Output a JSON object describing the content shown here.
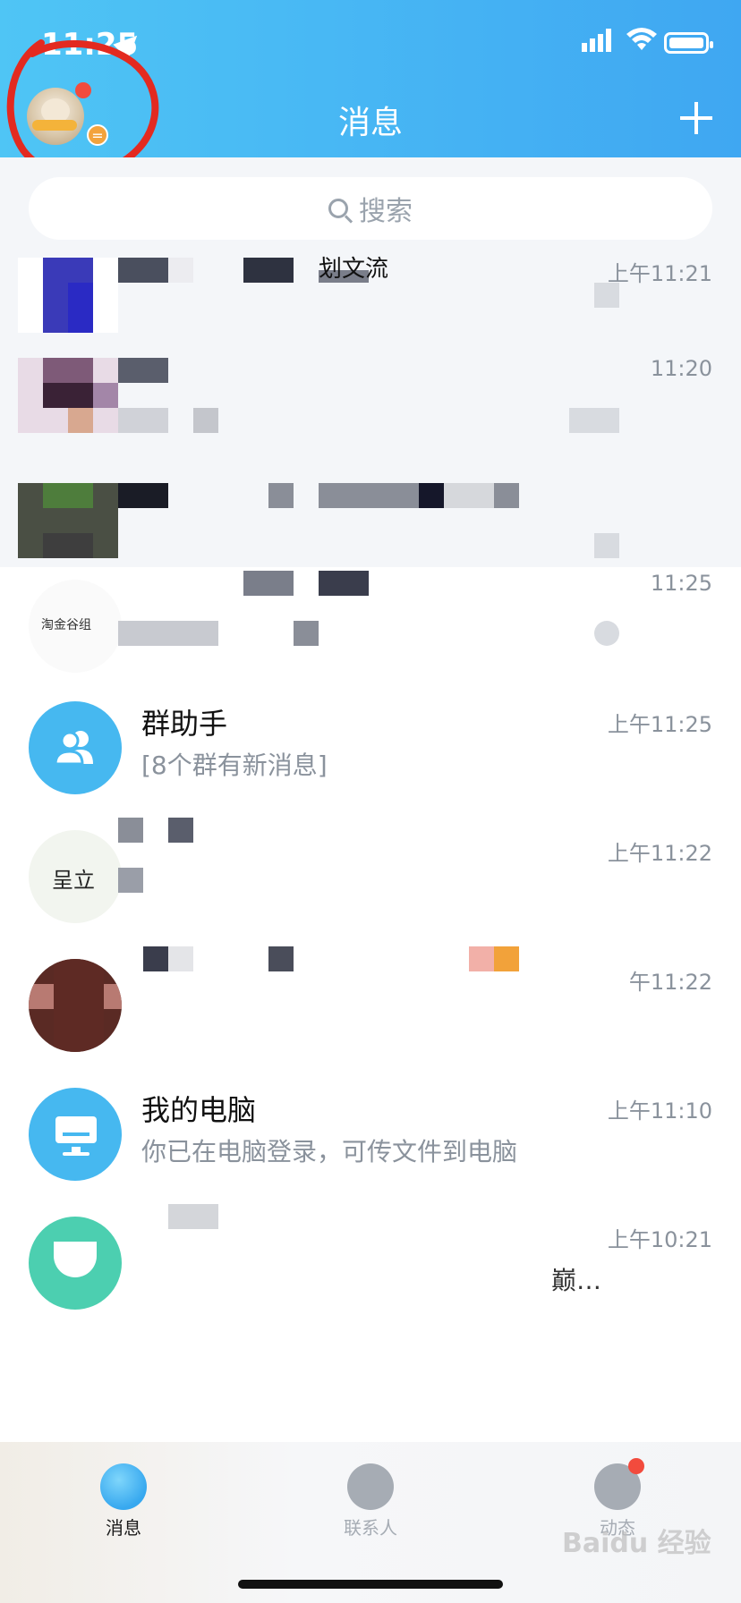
{
  "status_bar": {
    "time": "11:25"
  },
  "header": {
    "title": "消息"
  },
  "search": {
    "placeholder": "搜索"
  },
  "conversations": [
    {
      "name": "划文流",
      "preview": "",
      "time": "上午11:21"
    },
    {
      "name": "",
      "preview": "",
      "time": "11:20"
    },
    {
      "name": "",
      "preview": "",
      "time": ""
    },
    {
      "name": "",
      "preview": "",
      "time": "11:25",
      "avatar_text": "淘金谷组"
    },
    {
      "name": "群助手",
      "preview": "[8个群有新消息]",
      "time": "上午11:25"
    },
    {
      "name": "",
      "preview": "",
      "time": "上午11:22",
      "avatar_text": "呈立"
    },
    {
      "name": "",
      "preview": "",
      "time": "午11:22"
    },
    {
      "name": "我的电脑",
      "preview": "你已在电脑登录，可传文件到电脑",
      "time": "上午11:10"
    },
    {
      "name": "",
      "preview": "巅…",
      "time": "上午10:21"
    }
  ],
  "tabbar": {
    "tabs": [
      {
        "label": "消息",
        "icon": "chat-bubble-icon",
        "active": true
      },
      {
        "label": "联系人",
        "icon": "contacts-icon",
        "active": false
      },
      {
        "label": "动态",
        "icon": "star-planet-icon",
        "active": false,
        "badge": true
      }
    ]
  },
  "watermark": "Baidu 经验"
}
